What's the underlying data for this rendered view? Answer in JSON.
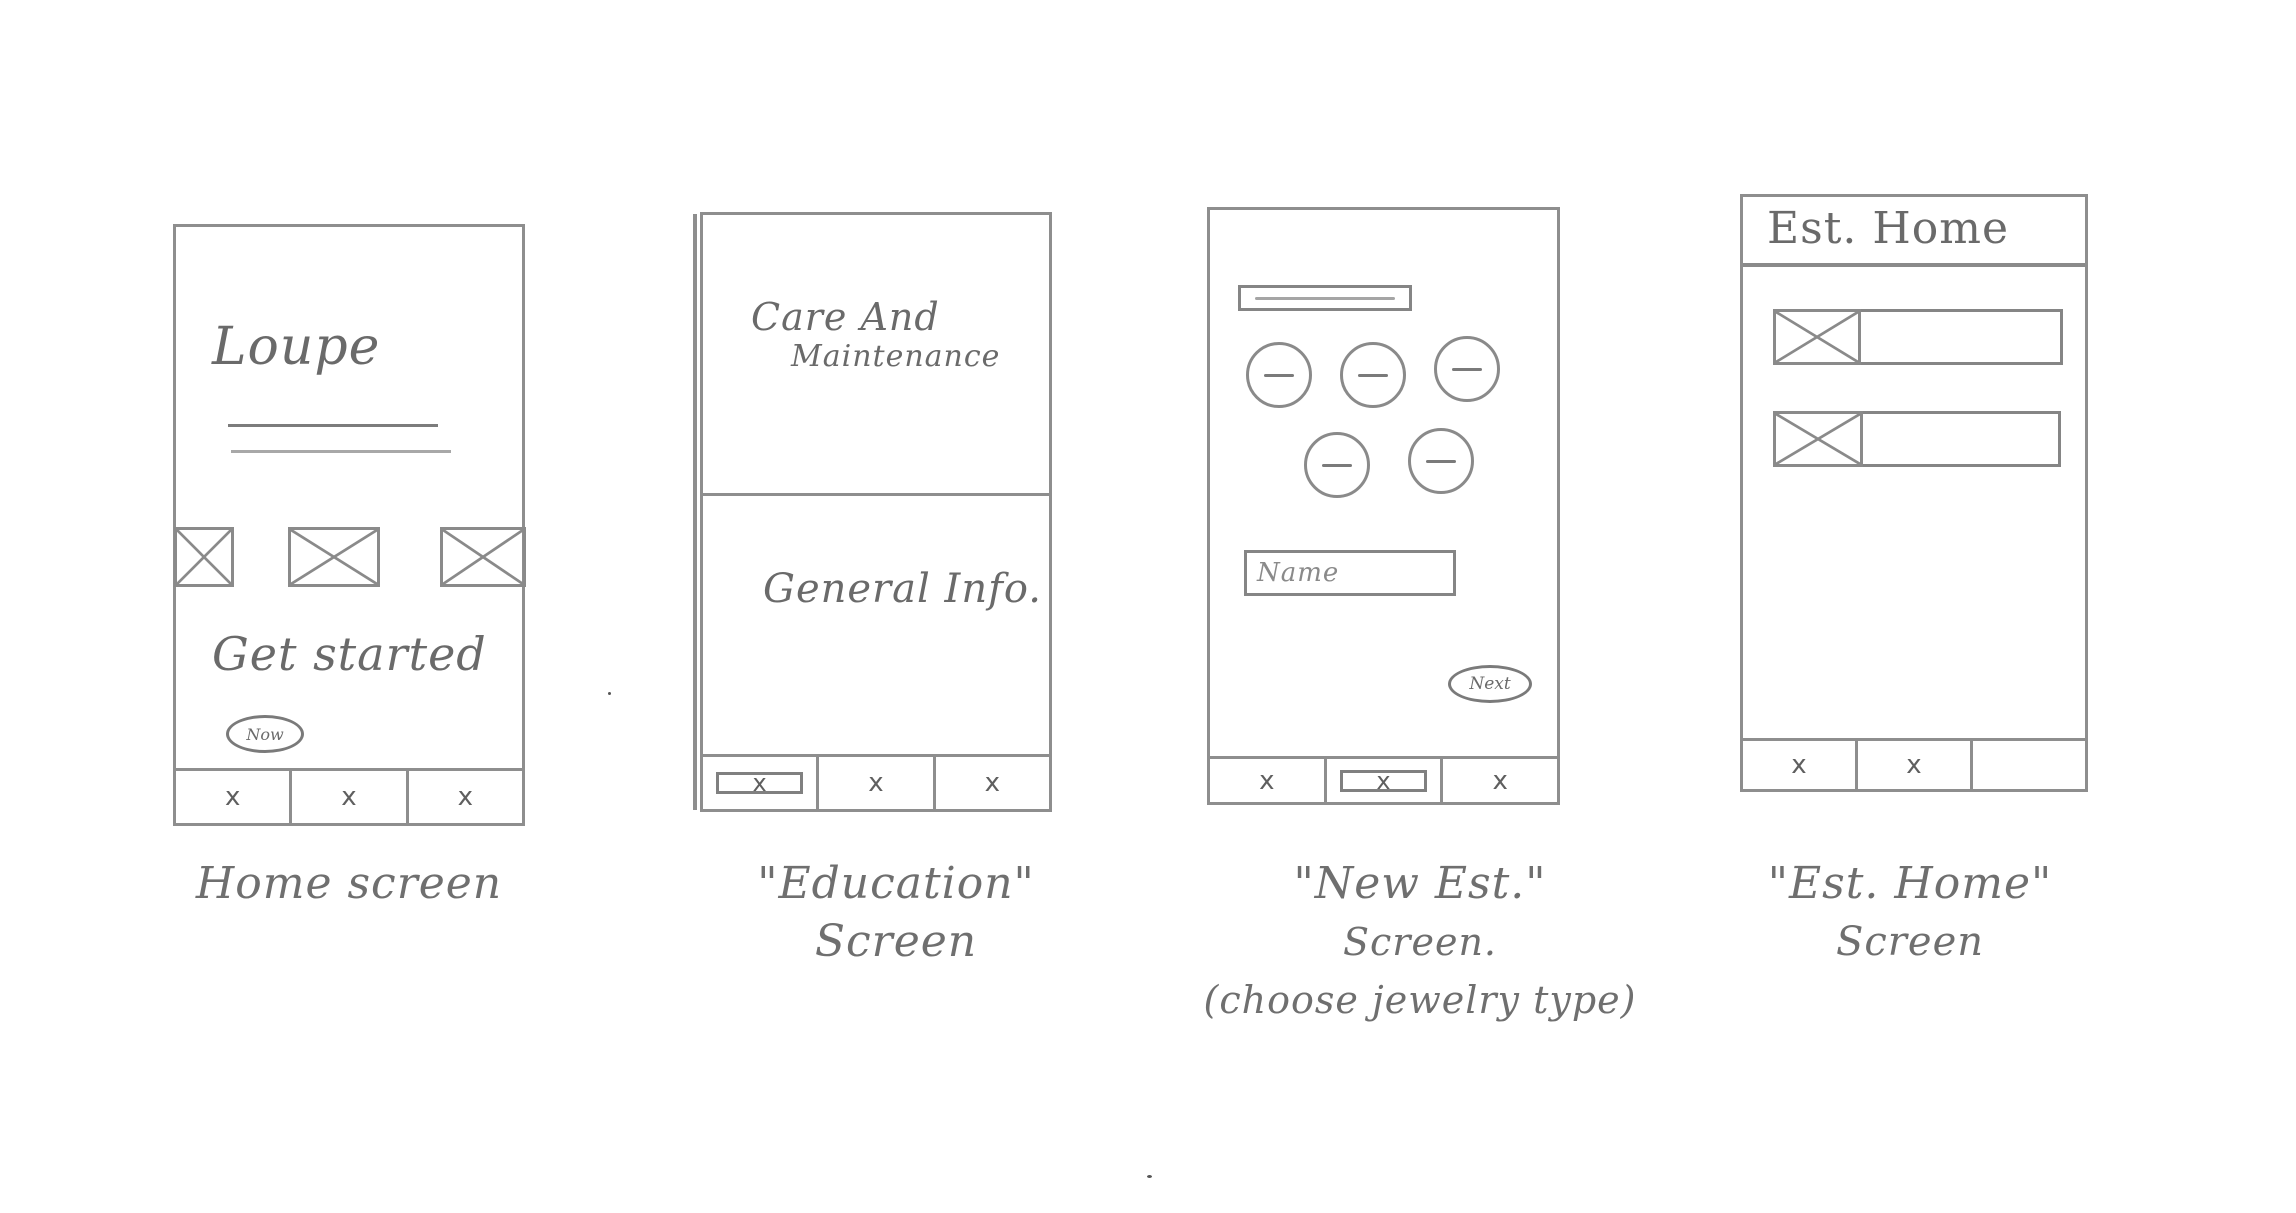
{
  "sketch": {
    "screens": [
      {
        "id": "home",
        "caption": [
          "Home screen"
        ],
        "app_title": "Loupe",
        "cta_text": "Get started",
        "cta_button": "Now",
        "tabs": [
          "x",
          "x",
          "x"
        ],
        "image_placeholders": 3
      },
      {
        "id": "education",
        "caption": [
          "\"Education\"",
          "Screen"
        ],
        "sections": [
          {
            "title_lines": [
              "Care And",
              "Maintenance"
            ]
          },
          {
            "title_lines": [
              "General Info."
            ]
          }
        ],
        "tabs": [
          "x",
          "x",
          "x"
        ],
        "selected_tab": 0
      },
      {
        "id": "new-est",
        "caption": [
          "\"New Est.\"",
          "Screen.",
          "(choose jewelry type)"
        ],
        "header_bar_text": "~~~~~~~~",
        "jewelry_type_options": [
          "—",
          "—",
          "—",
          "—",
          "—"
        ],
        "name_field_placeholder": "Name",
        "next_button": "Next",
        "tabs": [
          "x",
          "x",
          "x"
        ],
        "selected_tab": 1
      },
      {
        "id": "est-home",
        "caption": [
          "\"Est. Home\"",
          "Screen"
        ],
        "header_title": "Est. Home",
        "list_items": 2,
        "tabs": [
          "x",
          "x",
          ""
        ]
      }
    ]
  }
}
